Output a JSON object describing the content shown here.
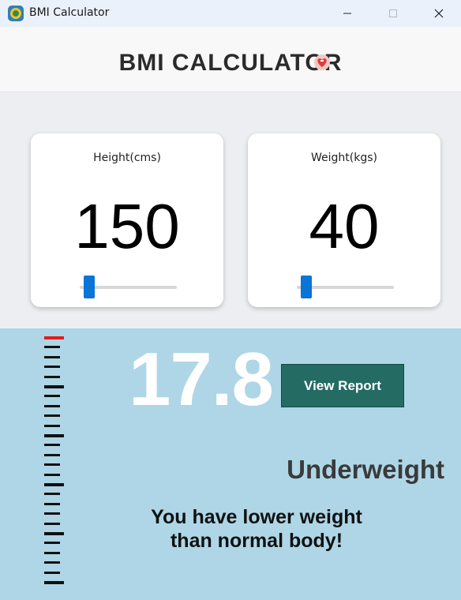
{
  "window": {
    "title": "BMI Calculator"
  },
  "header": {
    "title": "BMI CALCULATOR"
  },
  "height_card": {
    "label": "Height(cms)",
    "value": "150",
    "slider_level": 0.05
  },
  "weight_card": {
    "label": "Weight(kgs)",
    "value": "40",
    "slider_level": 0.05
  },
  "result": {
    "bmi": "17.8",
    "report_button": "View Report",
    "category": "Underweight",
    "message_line1": "You have lower weight",
    "message_line2": "than normal body!"
  },
  "colors": {
    "accent_blue": "#0a74d8",
    "report_button": "#236b63",
    "result_panel": "#aed6e6",
    "marker_red": "#e41b1b"
  },
  "icons": {
    "app": "bmi-app-icon",
    "minimize": "minimize-icon",
    "maximize": "maximize-icon",
    "close": "close-icon",
    "header": "heart-icon"
  }
}
